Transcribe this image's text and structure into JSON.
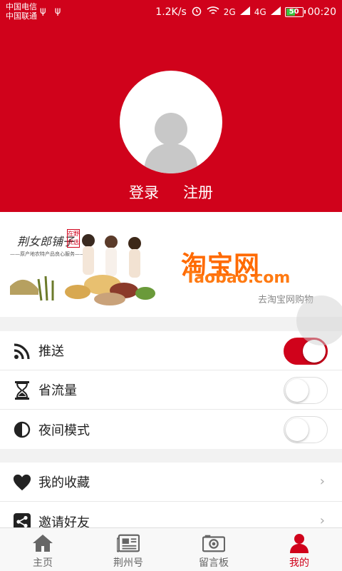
{
  "status_bar": {
    "carrier1": "中国电信",
    "carrier2": "中国联通",
    "usb": "ψ ψ",
    "net_speed": "1.2K/s",
    "net_2g": "2G",
    "net_4g": "4G",
    "battery": "50",
    "time": "00:20"
  },
  "header": {
    "login": "登录",
    "register": "注册"
  },
  "banner": {
    "brand": "荆女郎铺子",
    "seal": "在野优选",
    "slogan": "——原产地农特产品良心服务——",
    "taobao_cn": "淘宝网",
    "taobao_en": "Taobao.com",
    "taobao_link": "去淘宝网购物"
  },
  "settings": [
    {
      "label": "推送",
      "icon": "rss-icon",
      "state": "on"
    },
    {
      "label": "省流量",
      "icon": "hourglass-icon",
      "state": "off"
    },
    {
      "label": "夜间模式",
      "icon": "contrast-icon",
      "state": "off"
    }
  ],
  "menu": [
    {
      "label": "我的收藏",
      "icon": "heart-icon"
    },
    {
      "label": "邀请好友",
      "icon": "share-icon"
    }
  ],
  "tabs": [
    {
      "label": "主页",
      "icon": "home-icon",
      "active": false
    },
    {
      "label": "荆州号",
      "icon": "newspaper-icon",
      "active": false
    },
    {
      "label": "留言板",
      "icon": "camera-icon",
      "active": false
    },
    {
      "label": "我的",
      "icon": "user-icon",
      "active": true
    }
  ],
  "colors": {
    "accent": "#d0021b",
    "taobao": "#ff6a00"
  }
}
